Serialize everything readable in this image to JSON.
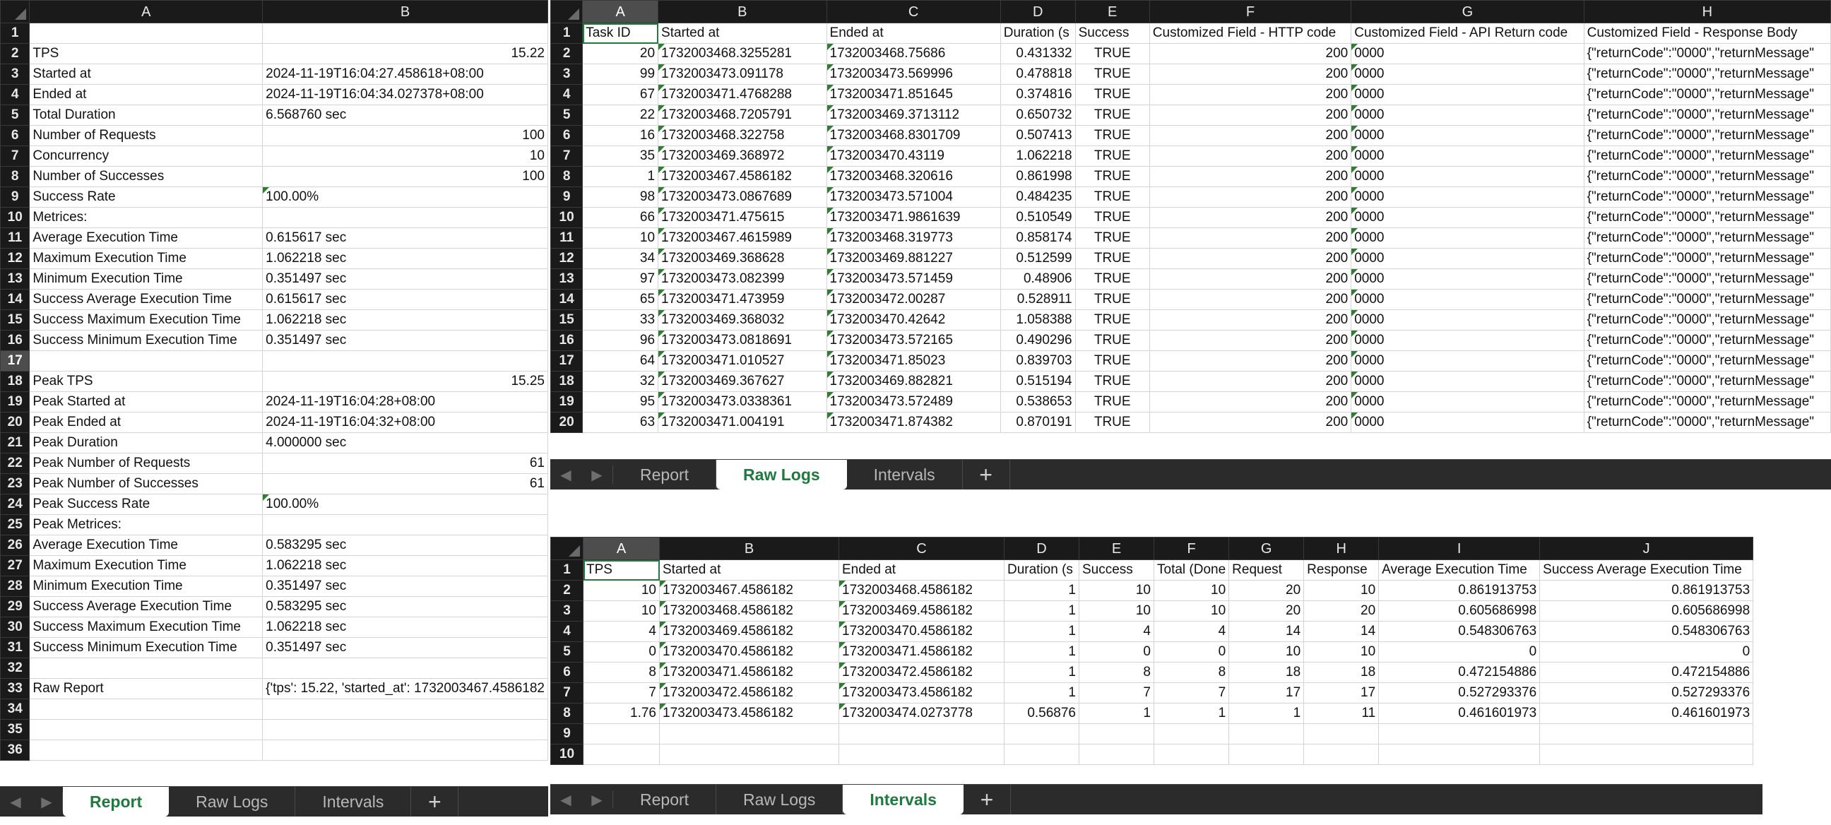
{
  "tabs": [
    "Report",
    "Raw Logs",
    "Intervals"
  ],
  "add_sheet": "+",
  "nav": {
    "prev": "◀",
    "next": "▶"
  },
  "report": {
    "active_tab": 0,
    "columns": [
      "A",
      "B"
    ],
    "rows": [
      [
        "",
        ""
      ],
      [
        "TPS",
        "15.22"
      ],
      [
        "Started at",
        "2024-11-19T16:04:27.458618+08:00"
      ],
      [
        "Ended at",
        "2024-11-19T16:04:34.027378+08:00"
      ],
      [
        "Total Duration",
        "6.568760 sec"
      ],
      [
        "Number of Requests",
        "100"
      ],
      [
        "Concurrency",
        "10"
      ],
      [
        "Number of Successes",
        "100"
      ],
      [
        "Success Rate",
        "100.00%"
      ],
      [
        "Metrices:",
        ""
      ],
      [
        "Average Execution Time",
        "0.615617 sec"
      ],
      [
        "Maximum Execution Time",
        "1.062218 sec"
      ],
      [
        "Minimum Execution Time",
        "0.351497 sec"
      ],
      [
        "Success Average Execution Time",
        "0.615617 sec"
      ],
      [
        "Success Maximum Execution Time",
        "1.062218 sec"
      ],
      [
        "Success Minimum Execution Time",
        "0.351497 sec"
      ],
      [
        "",
        ""
      ],
      [
        "Peak TPS",
        "15.25"
      ],
      [
        "Peak Started at",
        "2024-11-19T16:04:28+08:00"
      ],
      [
        "Peak Ended at",
        "2024-11-19T16:04:32+08:00"
      ],
      [
        "Peak Duration",
        "4.000000 sec"
      ],
      [
        "Peak Number of Requests",
        "61"
      ],
      [
        "Peak Number of Successes",
        "61"
      ],
      [
        "Peak Success Rate",
        "100.00%"
      ],
      [
        "Peak Metrices:",
        ""
      ],
      [
        "Average Execution Time",
        "0.583295 sec"
      ],
      [
        "Maximum Execution Time",
        "1.062218 sec"
      ],
      [
        "Minimum Execution Time",
        "0.351497 sec"
      ],
      [
        "Success Average Execution Time",
        "0.583295 sec"
      ],
      [
        "Success Maximum Execution Time",
        "1.062218 sec"
      ],
      [
        "Success Minimum Execution Time",
        "0.351497 sec"
      ],
      [
        "",
        ""
      ],
      [
        "Raw Report",
        "{'tps': 15.22, 'started_at': 1732003467.4586182"
      ],
      [
        "",
        ""
      ],
      [
        "",
        ""
      ],
      [
        "",
        ""
      ]
    ]
  },
  "raw_logs": {
    "active_tab": 1,
    "columns": [
      "A",
      "B",
      "C",
      "D",
      "E",
      "F",
      "G",
      "H"
    ],
    "header": [
      "Task ID",
      "Started at",
      "Ended at",
      "Duration (s",
      "Success",
      "Customized Field - HTTP code",
      "Customized Field - API Return code",
      "Customized Field - Response Body"
    ],
    "rows": [
      [
        "20",
        "1732003468.3255281",
        "1732003468.75686",
        "0.431332",
        "TRUE",
        "200",
        "0000",
        "{\"returnCode\":\"0000\",\"returnMessage\""
      ],
      [
        "99",
        "1732003473.091178",
        "1732003473.569996",
        "0.478818",
        "TRUE",
        "200",
        "0000",
        "{\"returnCode\":\"0000\",\"returnMessage\""
      ],
      [
        "67",
        "1732003471.4768288",
        "1732003471.851645",
        "0.374816",
        "TRUE",
        "200",
        "0000",
        "{\"returnCode\":\"0000\",\"returnMessage\""
      ],
      [
        "22",
        "1732003468.7205791",
        "1732003469.3713112",
        "0.650732",
        "TRUE",
        "200",
        "0000",
        "{\"returnCode\":\"0000\",\"returnMessage\""
      ],
      [
        "16",
        "1732003468.322758",
        "1732003468.8301709",
        "0.507413",
        "TRUE",
        "200",
        "0000",
        "{\"returnCode\":\"0000\",\"returnMessage\""
      ],
      [
        "35",
        "1732003469.368972",
        "1732003470.43119",
        "1.062218",
        "TRUE",
        "200",
        "0000",
        "{\"returnCode\":\"0000\",\"returnMessage\""
      ],
      [
        "1",
        "1732003467.4586182",
        "1732003468.320616",
        "0.861998",
        "TRUE",
        "200",
        "0000",
        "{\"returnCode\":\"0000\",\"returnMessage\""
      ],
      [
        "98",
        "1732003473.0867689",
        "1732003473.571004",
        "0.484235",
        "TRUE",
        "200",
        "0000",
        "{\"returnCode\":\"0000\",\"returnMessage\""
      ],
      [
        "66",
        "1732003471.475615",
        "1732003471.9861639",
        "0.510549",
        "TRUE",
        "200",
        "0000",
        "{\"returnCode\":\"0000\",\"returnMessage\""
      ],
      [
        "10",
        "1732003467.4615989",
        "1732003468.319773",
        "0.858174",
        "TRUE",
        "200",
        "0000",
        "{\"returnCode\":\"0000\",\"returnMessage\""
      ],
      [
        "34",
        "1732003469.368628",
        "1732003469.881227",
        "0.512599",
        "TRUE",
        "200",
        "0000",
        "{\"returnCode\":\"0000\",\"returnMessage\""
      ],
      [
        "97",
        "1732003473.082399",
        "1732003473.571459",
        "0.48906",
        "TRUE",
        "200",
        "0000",
        "{\"returnCode\":\"0000\",\"returnMessage\""
      ],
      [
        "65",
        "1732003471.473959",
        "1732003472.00287",
        "0.528911",
        "TRUE",
        "200",
        "0000",
        "{\"returnCode\":\"0000\",\"returnMessage\""
      ],
      [
        "33",
        "1732003469.368032",
        "1732003470.42642",
        "1.058388",
        "TRUE",
        "200",
        "0000",
        "{\"returnCode\":\"0000\",\"returnMessage\""
      ],
      [
        "96",
        "1732003473.0818691",
        "1732003473.572165",
        "0.490296",
        "TRUE",
        "200",
        "0000",
        "{\"returnCode\":\"0000\",\"returnMessage\""
      ],
      [
        "64",
        "1732003471.010527",
        "1732003471.85023",
        "0.839703",
        "TRUE",
        "200",
        "0000",
        "{\"returnCode\":\"0000\",\"returnMessage\""
      ],
      [
        "32",
        "1732003469.367627",
        "1732003469.882821",
        "0.515194",
        "TRUE",
        "200",
        "0000",
        "{\"returnCode\":\"0000\",\"returnMessage\""
      ],
      [
        "95",
        "1732003473.0338361",
        "1732003473.572489",
        "0.538653",
        "TRUE",
        "200",
        "0000",
        "{\"returnCode\":\"0000\",\"returnMessage\""
      ],
      [
        "63",
        "1732003471.004191",
        "1732003471.874382",
        "0.870191",
        "TRUE",
        "200",
        "0000",
        "{\"returnCode\":\"0000\",\"returnMessage\""
      ]
    ]
  },
  "intervals": {
    "active_tab": 2,
    "columns": [
      "A",
      "B",
      "C",
      "D",
      "E",
      "F",
      "G",
      "H",
      "I",
      "J"
    ],
    "header": [
      "TPS",
      "Started at",
      "Ended at",
      "Duration (s",
      "Success",
      "Total (Done",
      "Request",
      "Response",
      "Average Execution Time",
      "Success Average Execution Time"
    ],
    "rows": [
      [
        "10",
        "1732003467.4586182",
        "1732003468.4586182",
        "1",
        "10",
        "10",
        "20",
        "10",
        "0.861913753",
        "0.861913753"
      ],
      [
        "10",
        "1732003468.4586182",
        "1732003469.4586182",
        "1",
        "10",
        "10",
        "20",
        "20",
        "0.605686998",
        "0.605686998"
      ],
      [
        "4",
        "1732003469.4586182",
        "1732003470.4586182",
        "1",
        "4",
        "4",
        "14",
        "14",
        "0.548306763",
        "0.548306763"
      ],
      [
        "0",
        "1732003470.4586182",
        "1732003471.4586182",
        "1",
        "0",
        "0",
        "10",
        "10",
        "0",
        "0"
      ],
      [
        "8",
        "1732003471.4586182",
        "1732003472.4586182",
        "1",
        "8",
        "8",
        "18",
        "18",
        "0.472154886",
        "0.472154886"
      ],
      [
        "7",
        "1732003472.4586182",
        "1732003473.4586182",
        "1",
        "7",
        "7",
        "17",
        "17",
        "0.527293376",
        "0.527293376"
      ],
      [
        "1.76",
        "1732003473.4586182",
        "1732003474.0273778",
        "0.56876",
        "1",
        "1",
        "1",
        "11",
        "0.461601973",
        "0.461601973"
      ],
      [
        "",
        "",
        "",
        "",
        "",
        "",
        "",
        "",
        "",
        ""
      ],
      [
        "",
        "",
        "",
        "",
        "",
        "",
        "",
        "",
        "",
        ""
      ]
    ]
  },
  "colors": {
    "accent": "#1f7a3e",
    "header_bg": "#1a1a1a",
    "tabbar_bg": "#2b2b2b",
    "triangle": "#2e7d32"
  }
}
